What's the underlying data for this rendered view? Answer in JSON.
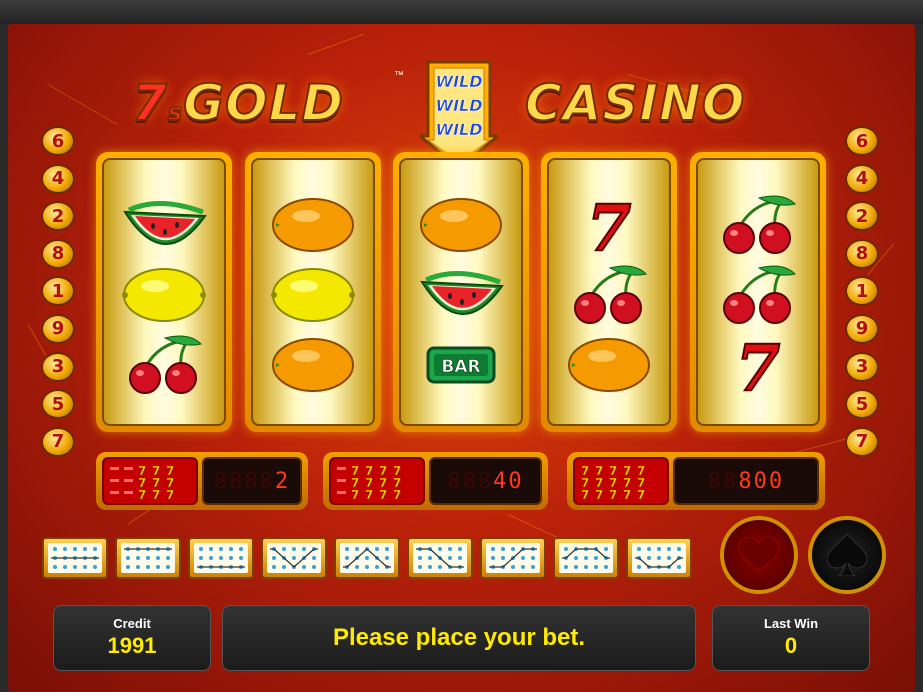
{
  "logo": {
    "left_seven": "7",
    "left_s": "s",
    "left_word": "GOLD",
    "trademark": "™",
    "right_word": "CASINO",
    "wild_words": [
      "WILD",
      "WILD",
      "WILD"
    ]
  },
  "side_lamps": {
    "left": [
      "6",
      "4",
      "2",
      "8",
      "1",
      "9",
      "3",
      "5",
      "7"
    ],
    "right": [
      "6",
      "4",
      "2",
      "8",
      "1",
      "9",
      "3",
      "5",
      "7"
    ]
  },
  "reels": [
    [
      "watermelon",
      "lemon",
      "cherries"
    ],
    [
      "orange",
      "lemon",
      "orange"
    ],
    [
      "orange",
      "watermelon",
      "bar"
    ],
    [
      "seven",
      "cherries",
      "orange"
    ],
    [
      "cherries",
      "cherries",
      "seven"
    ]
  ],
  "symbols": {
    "bar_label": "BAR",
    "seven_label": "7"
  },
  "payouts": [
    {
      "sevens": 3,
      "value": "2",
      "ghost": "8888"
    },
    {
      "sevens": 4,
      "value": "40",
      "ghost": "888"
    },
    {
      "sevens": 5,
      "value": "800",
      "ghost": "88"
    }
  ],
  "line_buttons": [
    "line-1",
    "line-2",
    "line-3",
    "line-4",
    "line-5",
    "line-6",
    "line-7",
    "line-8",
    "line-9"
  ],
  "gamble_buttons": {
    "red": "heart-icon",
    "black": "spade-icon"
  },
  "footer": {
    "credit_label": "Credit",
    "credit_value": "1991",
    "message": "Please place your bet.",
    "last_win_label": "Last Win",
    "last_win_value": "0"
  },
  "colors": {
    "background": "#b8200a",
    "gold": "#ffd84a",
    "led_red": "#ff3a1a",
    "message_yellow": "#ffea00"
  }
}
